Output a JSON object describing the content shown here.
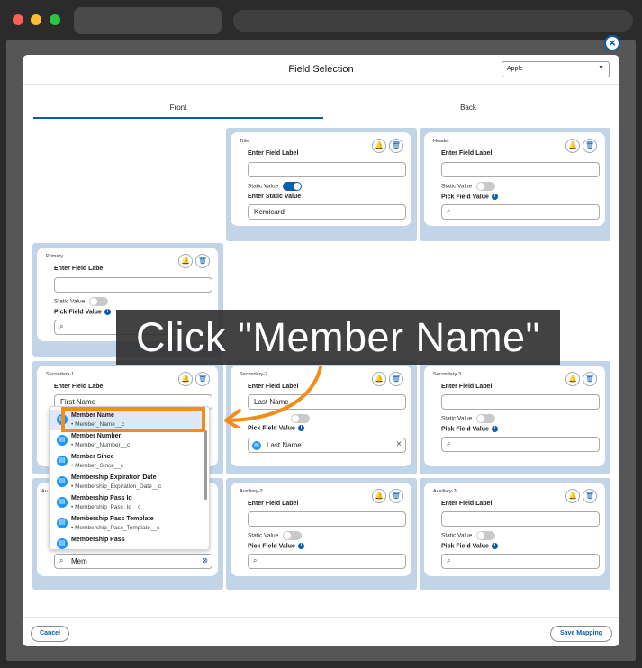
{
  "modal": {
    "title": "Field Selection",
    "platform_select": "Apple",
    "close_symbol": "×",
    "tabs": [
      "Front",
      "Back"
    ],
    "active_tab": "Front"
  },
  "cards": {
    "title": {
      "tag": "Title",
      "label": "Enter Field Label",
      "label_value": "",
      "static_label": "Static Value",
      "static_on": true,
      "static_value_label": "Enter Static Value",
      "static_value": "Kemicard"
    },
    "header": {
      "tag": "Header",
      "label": "Enter Field Label",
      "label_value": "",
      "static_label": "Static Value",
      "static_on": false,
      "pick_label": "Pick Field Value"
    },
    "primary": {
      "tag": "Primary",
      "label": "Enter Field Label",
      "label_value": "",
      "static_label": "Static Value",
      "static_on": false,
      "pick_label": "Pick Field Value"
    },
    "secondary1": {
      "tag": "Secondary-1",
      "label": "Enter Field Label",
      "label_value": "First Name"
    },
    "secondary2": {
      "tag": "Secondary-2",
      "label": "Enter Field Label",
      "label_value": "Last Name",
      "pick_label": "Pick Field Value",
      "pick_value": "Last Name"
    },
    "secondary3": {
      "tag": "Secondary-3",
      "label": "Enter Field Label",
      "label_value": "",
      "static_label": "Static Value",
      "static_on": false,
      "pick_label": "Pick Field Value"
    },
    "auxiliary1": {
      "tag": "Au",
      "search_value": "Mem"
    },
    "auxiliary2": {
      "tag": "Auxiliary-2",
      "label": "Enter Field Label",
      "label_value": "",
      "static_label": "Static Value",
      "static_on": false,
      "pick_label": "Pick Field Value"
    },
    "auxiliary3": {
      "tag": "Auxiliary-3",
      "label": "Enter Field Label",
      "label_value": "",
      "static_label": "Static Value",
      "static_on": false,
      "pick_label": "Pick Field Value"
    }
  },
  "dropdown": {
    "items": [
      {
        "name": "Member Name",
        "api": "• Member_Name__c"
      },
      {
        "name": "Member Number",
        "api": "• Member_Number__c"
      },
      {
        "name": "Member Since",
        "api": "• Member_Since__c"
      },
      {
        "name": "Membership Expiration Date",
        "api": "• Membership_Expiration_Date__c"
      },
      {
        "name": "Membership Pass Id",
        "api": "• Membership_Pass_Id__c"
      },
      {
        "name": "Membership Pass Template",
        "api": "• Membership_Pass_Template__c"
      },
      {
        "name": "Membership Pass",
        "api": ""
      }
    ],
    "selected_index": 0
  },
  "annotation": {
    "text": "Click \"Member Name\"",
    "color": "#f28c1b"
  },
  "footer": {
    "cancel": "Cancel",
    "save": "Save Mapping"
  },
  "colors": {
    "accent": "#0b5cab",
    "section_bg": "#c2d4e8"
  },
  "icons": {
    "notify": "bell-icon",
    "delete": "trash-icon",
    "search": "search-icon",
    "field": "field-icon"
  }
}
